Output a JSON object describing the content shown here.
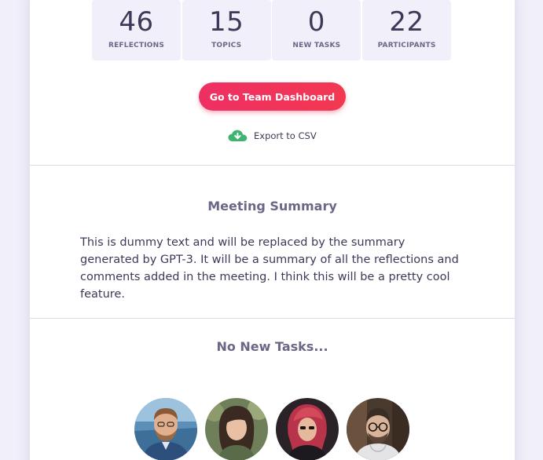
{
  "stats": [
    {
      "value": "46",
      "label": "REFLECTIONS"
    },
    {
      "value": "15",
      "label": "TOPICS"
    },
    {
      "value": "0",
      "label": "NEW TASKS"
    },
    {
      "value": "22",
      "label": "PARTICIPANTS"
    }
  ],
  "actions": {
    "dashboard_label": "Go to Team Dashboard",
    "export_label": "Export to CSV",
    "export_icon": "cloud-download-icon"
  },
  "summary": {
    "title": "Meeting Summary",
    "body": "This is dummy text and will be replaced by the summary generated by GPT-3. It will be a summary of all the reflections and comments added in the meeting. I think this will be a pretty cool feature."
  },
  "tasks": {
    "title": "No New Tasks..."
  },
  "colors": {
    "background": "#f1f0fa",
    "accent": "#f0305a",
    "export_icon": "#3fb36f",
    "text_dark": "#3d3958",
    "text_muted": "#6b6887"
  }
}
